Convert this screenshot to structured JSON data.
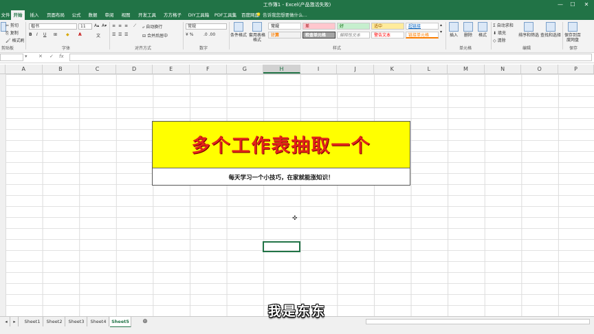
{
  "window": {
    "title": "工作簿1 - Excel(产品激活失败)",
    "minimize_glyph": "—",
    "maximize_glyph": "☐",
    "close_glyph": "✕"
  },
  "tabs": [
    "文件",
    "开始",
    "插入",
    "页面布局",
    "公式",
    "数据",
    "审阅",
    "视图",
    "开发工具",
    "方方格子",
    "DIY工具箱",
    "PDF工具集",
    "百度网盘"
  ],
  "tell_me": "告诉我您想要做什么...",
  "ribbon": {
    "clipboard": {
      "cut": "剪切",
      "copy": "复制",
      "format_painter": "格式刷",
      "label": "剪贴板"
    },
    "font": {
      "name": "楷书",
      "size": "11",
      "label": "字体"
    },
    "alignment": {
      "wrap": "自动换行",
      "merge": "合并后居中",
      "label": "对齐方式"
    },
    "number": {
      "format": "常规",
      "label": "数字"
    },
    "styles": {
      "conditional": "条件格式",
      "table": "套用表格格式",
      "cells": [
        {
          "text": "常规",
          "bg": "#ffffff",
          "fg": "#000000"
        },
        {
          "text": "差",
          "bg": "#ffc7ce",
          "fg": "#9c0006"
        },
        {
          "text": "好",
          "bg": "#c6efce",
          "fg": "#006100"
        },
        {
          "text": "适中",
          "bg": "#ffeb9c",
          "fg": "#9c5700"
        },
        {
          "text": "超链接",
          "bg": "#ffffff",
          "fg": "#0563c1"
        },
        {
          "text": "计算",
          "bg": "#f2f2f2",
          "fg": "#fa7d00"
        },
        {
          "text": "检查单元格",
          "bg": "#a5a5a5",
          "fg": "#ffffff"
        },
        {
          "text": "解释性文本",
          "bg": "#ffffff",
          "fg": "#7f7f7f"
        },
        {
          "text": "警告文本",
          "bg": "#ffffff",
          "fg": "#ff0000"
        },
        {
          "text": "链接单元格",
          "bg": "#ffffff",
          "fg": "#fa7d00"
        }
      ],
      "label": "样式"
    },
    "cells_group": {
      "insert": "插入",
      "delete": "删除",
      "format": "格式",
      "label": "单元格"
    },
    "editing": {
      "autosum": "自动求和",
      "fill": "填充",
      "clear": "清除",
      "sort": "排序和筛选",
      "find": "查找和选择",
      "label": "编辑"
    },
    "save": {
      "button": "保存到百度网盘",
      "label": "保存"
    }
  },
  "formula_bar": {
    "cancel": "✕",
    "enter": "✓",
    "fx": "fx"
  },
  "columns": [
    "A",
    "B",
    "C",
    "D",
    "E",
    "F",
    "G",
    "H",
    "I",
    "J",
    "K",
    "L",
    "M",
    "N",
    "O",
    "P"
  ],
  "selected_column": "H",
  "banner": {
    "title": "多个工作表抽取一个",
    "subtitle": "每天学习一个小技巧，在家就能涨知识！"
  },
  "sheets": [
    "Sheet1",
    "Sheet2",
    "Sheet3",
    "Sheet4",
    "Sheet5"
  ],
  "active_sheet": "Sheet5",
  "add_sheet": "⊕",
  "caption": "我是东东"
}
